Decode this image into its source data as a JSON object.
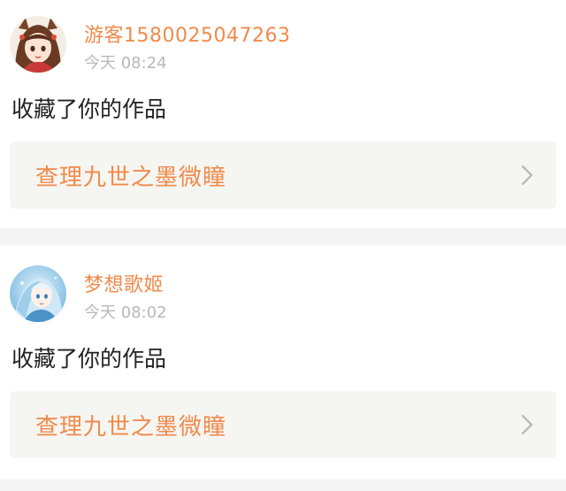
{
  "notifications": [
    {
      "username": "游客1580025047263",
      "time": "今天 08:24",
      "action": "收藏了你的作品",
      "work_title": "查理九世之墨微瞳",
      "avatar_icon": "anime-girl-avatar-icon"
    },
    {
      "username": "梦想歌姬",
      "time": "今天 08:02",
      "action": "收藏了你的作品",
      "work_title": "查理九世之墨微瞳",
      "avatar_icon": "anime-blue-girl-avatar-icon"
    }
  ],
  "colors": {
    "accent": "#f08a4b",
    "muted": "#b8b8b8",
    "text": "#222222",
    "link_bg": "#f5f5f1",
    "divider": "#f4f4f4"
  }
}
